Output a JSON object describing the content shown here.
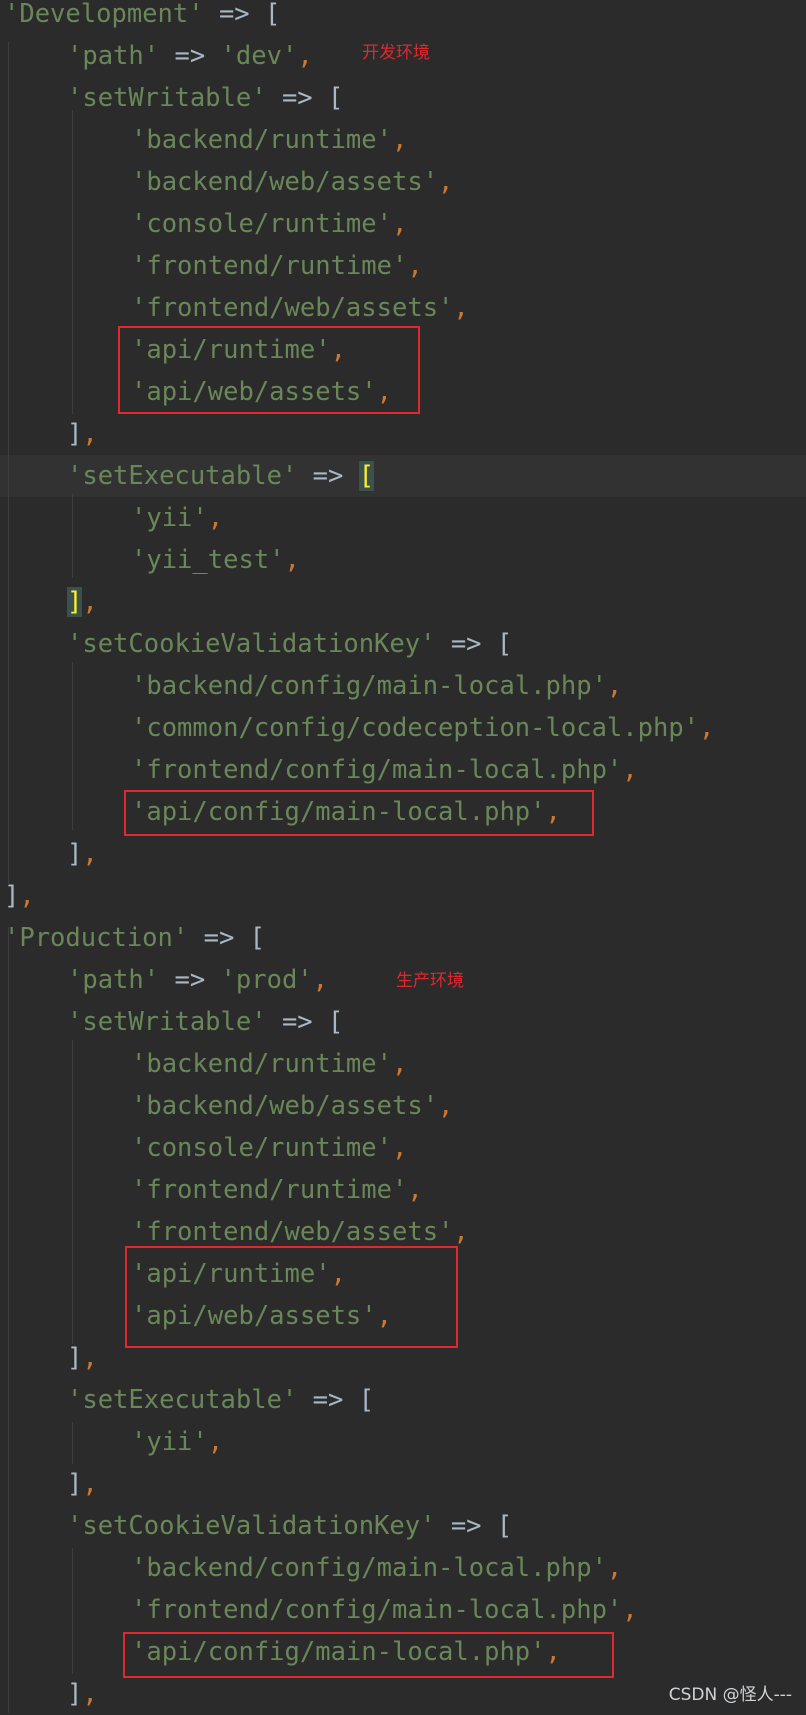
{
  "lines": [
    {
      "indent": 0,
      "parts": [
        [
          "str",
          "'Development'"
        ],
        [
          "op",
          " => "
        ],
        [
          "brk",
          "["
        ]
      ]
    },
    {
      "indent": 1,
      "parts": [
        [
          "str",
          "'path'"
        ],
        [
          "op",
          " => "
        ],
        [
          "str",
          "'dev'"
        ],
        [
          "punc",
          ","
        ]
      ]
    },
    {
      "indent": 1,
      "parts": [
        [
          "str",
          "'setWritable'"
        ],
        [
          "op",
          " => "
        ],
        [
          "brk",
          "["
        ]
      ]
    },
    {
      "indent": 2,
      "parts": [
        [
          "str",
          "'backend/runtime'"
        ],
        [
          "punc",
          ","
        ]
      ]
    },
    {
      "indent": 2,
      "parts": [
        [
          "str",
          "'backend/web/assets'"
        ],
        [
          "punc",
          ","
        ]
      ]
    },
    {
      "indent": 2,
      "parts": [
        [
          "str",
          "'console/runtime'"
        ],
        [
          "punc",
          ","
        ]
      ]
    },
    {
      "indent": 2,
      "parts": [
        [
          "str",
          "'frontend/runtime'"
        ],
        [
          "punc",
          ","
        ]
      ]
    },
    {
      "indent": 2,
      "parts": [
        [
          "str",
          "'frontend/web/assets'"
        ],
        [
          "punc",
          ","
        ]
      ]
    },
    {
      "indent": 2,
      "parts": [
        [
          "str",
          "'api/runtime'"
        ],
        [
          "punc",
          ","
        ]
      ]
    },
    {
      "indent": 2,
      "parts": [
        [
          "str",
          "'api/web/assets'"
        ],
        [
          "punc",
          ","
        ]
      ]
    },
    {
      "indent": 1,
      "parts": [
        [
          "brk",
          "]"
        ],
        [
          "punc",
          ","
        ]
      ]
    },
    {
      "indent": 1,
      "caret": true,
      "parts": [
        [
          "str",
          "'setExecutable'"
        ],
        [
          "op",
          " => "
        ],
        [
          "brkm",
          "["
        ]
      ]
    },
    {
      "indent": 2,
      "parts": [
        [
          "str",
          "'yii'"
        ],
        [
          "punc",
          ","
        ]
      ]
    },
    {
      "indent": 2,
      "parts": [
        [
          "str",
          "'yii_test'"
        ],
        [
          "punc",
          ","
        ]
      ]
    },
    {
      "indent": 1,
      "parts": [
        [
          "brkm",
          "]"
        ],
        [
          "punc",
          ","
        ]
      ]
    },
    {
      "indent": 1,
      "parts": [
        [
          "str",
          "'setCookieValidationKey'"
        ],
        [
          "op",
          " => "
        ],
        [
          "brk",
          "["
        ]
      ]
    },
    {
      "indent": 2,
      "parts": [
        [
          "str",
          "'backend/config/main-local.php'"
        ],
        [
          "punc",
          ","
        ]
      ]
    },
    {
      "indent": 2,
      "parts": [
        [
          "str",
          "'common/config/codeception-local.php'"
        ],
        [
          "punc",
          ","
        ]
      ]
    },
    {
      "indent": 2,
      "parts": [
        [
          "str",
          "'frontend/config/main-local.php'"
        ],
        [
          "punc",
          ","
        ]
      ]
    },
    {
      "indent": 2,
      "parts": [
        [
          "str",
          "'api/config/main-local.php'"
        ],
        [
          "punc",
          ","
        ]
      ]
    },
    {
      "indent": 1,
      "parts": [
        [
          "brk",
          "]"
        ],
        [
          "punc",
          ","
        ]
      ]
    },
    {
      "indent": 0,
      "parts": [
        [
          "brk",
          "]"
        ],
        [
          "punc",
          ","
        ]
      ]
    },
    {
      "indent": 0,
      "parts": [
        [
          "str",
          "'Production'"
        ],
        [
          "op",
          " => "
        ],
        [
          "brk",
          "["
        ]
      ]
    },
    {
      "indent": 1,
      "parts": [
        [
          "str",
          "'path'"
        ],
        [
          "op",
          " => "
        ],
        [
          "str",
          "'prod'"
        ],
        [
          "punc",
          ","
        ]
      ]
    },
    {
      "indent": 1,
      "parts": [
        [
          "str",
          "'setWritable'"
        ],
        [
          "op",
          " => "
        ],
        [
          "brk",
          "["
        ]
      ]
    },
    {
      "indent": 2,
      "parts": [
        [
          "str",
          "'backend/runtime'"
        ],
        [
          "punc",
          ","
        ]
      ]
    },
    {
      "indent": 2,
      "parts": [
        [
          "str",
          "'backend/web/assets'"
        ],
        [
          "punc",
          ","
        ]
      ]
    },
    {
      "indent": 2,
      "parts": [
        [
          "str",
          "'console/runtime'"
        ],
        [
          "punc",
          ","
        ]
      ]
    },
    {
      "indent": 2,
      "parts": [
        [
          "str",
          "'frontend/runtime'"
        ],
        [
          "punc",
          ","
        ]
      ]
    },
    {
      "indent": 2,
      "parts": [
        [
          "str",
          "'frontend/web/assets'"
        ],
        [
          "punc",
          ","
        ]
      ]
    },
    {
      "indent": 2,
      "parts": [
        [
          "str",
          "'api/runtime'"
        ],
        [
          "punc",
          ","
        ]
      ]
    },
    {
      "indent": 2,
      "parts": [
        [
          "str",
          "'api/web/assets'"
        ],
        [
          "punc",
          ","
        ]
      ]
    },
    {
      "indent": 1,
      "parts": [
        [
          "brk",
          "]"
        ],
        [
          "punc",
          ","
        ]
      ]
    },
    {
      "indent": 1,
      "parts": [
        [
          "str",
          "'setExecutable'"
        ],
        [
          "op",
          " => "
        ],
        [
          "brk",
          "["
        ]
      ]
    },
    {
      "indent": 2,
      "parts": [
        [
          "str",
          "'yii'"
        ],
        [
          "punc",
          ","
        ]
      ]
    },
    {
      "indent": 1,
      "parts": [
        [
          "brk",
          "]"
        ],
        [
          "punc",
          ","
        ]
      ]
    },
    {
      "indent": 1,
      "parts": [
        [
          "str",
          "'setCookieValidationKey'"
        ],
        [
          "op",
          " => "
        ],
        [
          "brk",
          "["
        ]
      ]
    },
    {
      "indent": 2,
      "parts": [
        [
          "str",
          "'backend/config/main-local.php'"
        ],
        [
          "punc",
          ","
        ]
      ]
    },
    {
      "indent": 2,
      "parts": [
        [
          "str",
          "'frontend/config/main-local.php'"
        ],
        [
          "punc",
          ","
        ]
      ]
    },
    {
      "indent": 2,
      "parts": [
        [
          "str",
          "'api/config/main-local.php'"
        ],
        [
          "punc",
          ","
        ]
      ]
    },
    {
      "indent": 1,
      "parts": [
        [
          "brk",
          "]"
        ],
        [
          "punc",
          ","
        ]
      ]
    }
  ],
  "annotations": {
    "dev_note": "开发环境",
    "prod_note": "生产环境"
  },
  "watermark": "CSDN @怪人---",
  "colors": {
    "background": "#2b2b2b",
    "string": "#6a8759",
    "punctuation": "#cc7832",
    "text": "#a9b7c6",
    "bracket_match": "#ffef28",
    "highlight_box": "#e0282e"
  }
}
